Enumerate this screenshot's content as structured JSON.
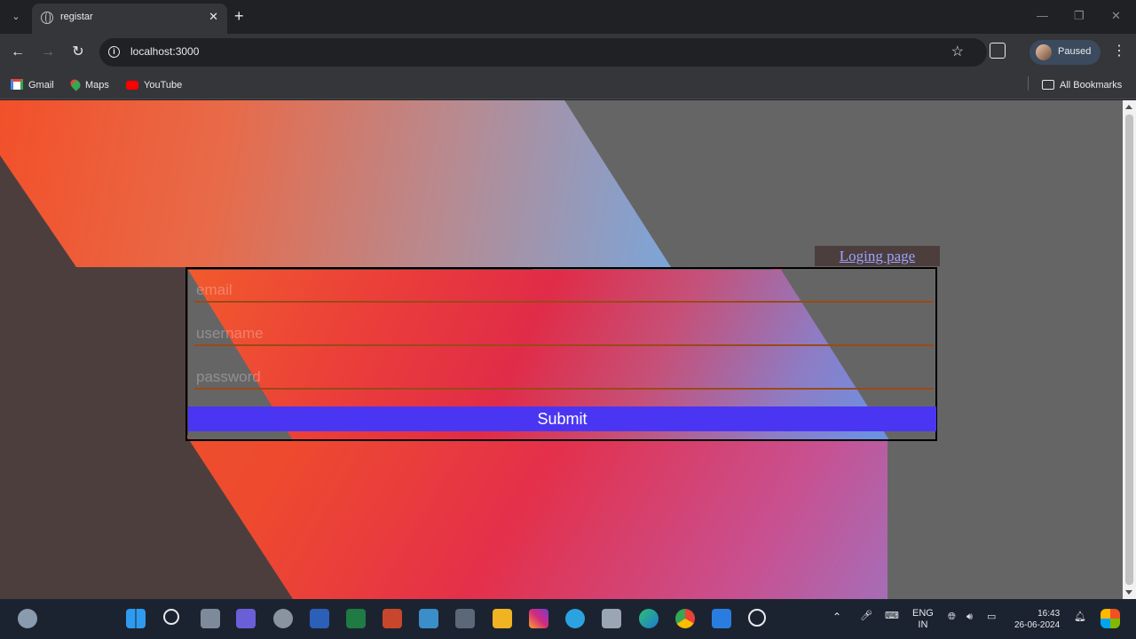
{
  "browser": {
    "tab_title": "registar",
    "url": "localhost:3000",
    "profile_status": "Paused",
    "bookmarks": [
      {
        "label": "Gmail"
      },
      {
        "label": "Maps"
      },
      {
        "label": "YouTube"
      }
    ],
    "all_bookmarks": "All Bookmarks"
  },
  "page": {
    "login_link": "Loging page",
    "fields": {
      "email_placeholder": "email",
      "username_placeholder": "username",
      "password_placeholder": "password"
    },
    "submit_label": "Submit"
  },
  "taskbar": {
    "lang_top": "ENG",
    "lang_bottom": "IN",
    "time": "16:43",
    "date": "26-06-2024"
  }
}
